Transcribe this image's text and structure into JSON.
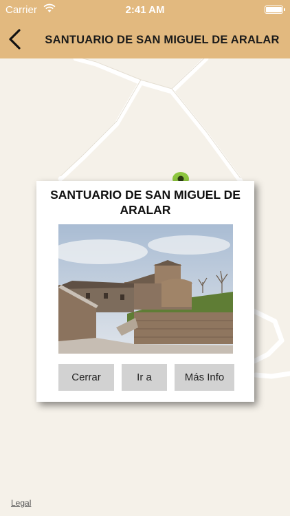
{
  "status_bar": {
    "carrier": "Carrier",
    "time": "2:41 AM",
    "wifi_icon": "wifi-icon",
    "battery_icon": "battery-icon"
  },
  "nav": {
    "back_icon": "chevron-left-icon",
    "title": "SANTUARIO DE SAN MIGUEL DE ARALAR"
  },
  "map": {
    "legal_label": "Legal",
    "pin_icon": "map-pin-icon"
  },
  "popup": {
    "title": "SANTUARIO DE SAN MIGUEL DE ARALAR",
    "photo_alt": "photo",
    "buttons": {
      "close": "Cerrar",
      "go": "Ir a",
      "info": "Más Info"
    }
  },
  "colors": {
    "bar": "#e2b97f",
    "map_bg": "#f5f1e9",
    "button_bg": "#d2d2d2",
    "pin": "#8dc63f"
  }
}
